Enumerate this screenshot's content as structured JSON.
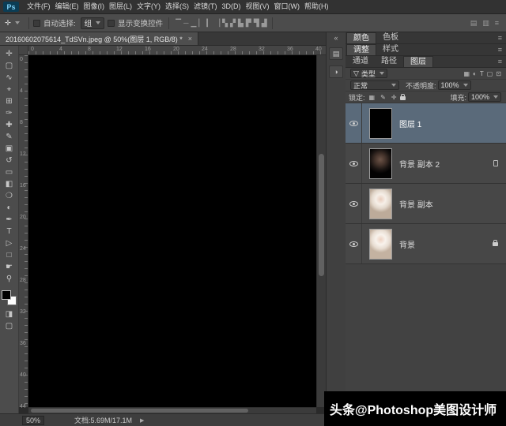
{
  "colors": {
    "ui_background": "#4c4c4c",
    "selected_layer_row": "#5a6a7a",
    "canvas_image": "#000000",
    "watermark_bg": "#000000",
    "watermark_text": "#ffffff"
  },
  "app": {
    "logo": "Ps",
    "menus": [
      "文件(F)",
      "编辑(E)",
      "图像(I)",
      "图层(L)",
      "文字(Y)",
      "选择(S)",
      "滤镜(T)",
      "3D(D)",
      "视图(V)",
      "窗口(W)",
      "帮助(H)"
    ]
  },
  "options_bar": {
    "tool_preset_icon": "✛",
    "auto_select": {
      "label": "自动选择:",
      "value": "组",
      "checked": false
    },
    "show_transform": {
      "label": "显示变换控件",
      "checked": false
    },
    "align_icons": [
      {
        "name": "align-top-edges-icon",
        "glyph": "▔"
      },
      {
        "name": "align-vertical-centers-icon",
        "glyph": "─"
      },
      {
        "name": "align-bottom-edges-icon",
        "glyph": "▁"
      },
      {
        "name": "align-left-edges-icon",
        "glyph": "▏"
      },
      {
        "name": "align-horizontal-centers-icon",
        "glyph": "▎"
      },
      {
        "name": "align-right-edges-icon",
        "glyph": "▕"
      },
      {
        "name": "distribute-top-icon",
        "glyph": "▚"
      },
      {
        "name": "distribute-vcenter-icon",
        "glyph": "▞"
      },
      {
        "name": "distribute-bottom-icon",
        "glyph": "▙"
      },
      {
        "name": "distribute-left-icon",
        "glyph": "▛"
      },
      {
        "name": "distribute-hcenter-icon",
        "glyph": "▜"
      },
      {
        "name": "distribute-right-icon",
        "glyph": "▟"
      }
    ],
    "right_icons": [
      {
        "name": "workspace-grid-icon",
        "glyph": "▤"
      },
      {
        "name": "workspace-columns-icon",
        "glyph": "▥"
      },
      {
        "name": "panel-list-icon",
        "glyph": "≡"
      }
    ]
  },
  "document_window": {
    "tab_title": "20160602075614_TdSVn.jpeg @ 50%(图层 1, RGB/8) *",
    "close_glyph": "×",
    "zoom": "50%",
    "doc_size": "文档:5.69M/17.1M",
    "flyout_glyph": "▶"
  },
  "toolbar": {
    "tools": [
      {
        "name": "move-tool",
        "glyph": "✛"
      },
      {
        "name": "marquee-tool",
        "glyph": "▢"
      },
      {
        "name": "lasso-tool",
        "glyph": "∿"
      },
      {
        "name": "quick-select-tool",
        "glyph": "⌖"
      },
      {
        "name": "crop-tool",
        "glyph": "⊞"
      },
      {
        "name": "eyedropper-tool",
        "glyph": "✑"
      },
      {
        "name": "healing-brush-tool",
        "glyph": "✚"
      },
      {
        "name": "brush-tool",
        "glyph": "✎"
      },
      {
        "name": "clone-stamp-tool",
        "glyph": "▣"
      },
      {
        "name": "history-brush-tool",
        "glyph": "↺"
      },
      {
        "name": "eraser-tool",
        "glyph": "▭"
      },
      {
        "name": "gradient-tool",
        "glyph": "◧"
      },
      {
        "name": "blur-tool",
        "glyph": "❍"
      },
      {
        "name": "dodge-tool",
        "glyph": "◐"
      },
      {
        "name": "pen-tool",
        "glyph": "✒"
      },
      {
        "name": "type-tool",
        "glyph": "T"
      },
      {
        "name": "path-select-tool",
        "glyph": "▷"
      },
      {
        "name": "shape-tool",
        "glyph": "□"
      },
      {
        "name": "hand-tool",
        "glyph": "☛"
      },
      {
        "name": "zoom-tool",
        "glyph": "⚲"
      }
    ],
    "bottom_tools": [
      {
        "name": "quick-mask-button",
        "glyph": "◨"
      },
      {
        "name": "screen-mode-button",
        "glyph": "▢"
      }
    ]
  },
  "rulers": {
    "h_labels": [
      "0",
      "4",
      "8",
      "12",
      "16",
      "20",
      "24",
      "28",
      "32",
      "36",
      "40"
    ],
    "v_labels": [
      "0",
      "4",
      "8",
      "12",
      "16",
      "20",
      "24",
      "28",
      "32",
      "36",
      "40",
      "44"
    ]
  },
  "dock": {
    "collapse_glyph": "«",
    "icons": [
      {
        "name": "docked-panel-icon-1",
        "glyph": "▤"
      },
      {
        "name": "docked-panel-icon-2",
        "glyph": "◑"
      }
    ]
  },
  "panels": {
    "panel_menu_glyph": "≡",
    "groups": [
      {
        "tabs": [
          {
            "label": "颜色",
            "active": true
          },
          {
            "label": "色板",
            "active": false
          }
        ]
      },
      {
        "tabs": [
          {
            "label": "调整",
            "active": true
          },
          {
            "label": "样式",
            "active": false
          }
        ]
      },
      {
        "tabs": [
          {
            "label": "通道",
            "active": false
          },
          {
            "label": "路径",
            "active": false
          },
          {
            "label": "图层",
            "active": true
          }
        ]
      }
    ],
    "layers_panel": {
      "filter": {
        "icon": "▽",
        "label": "类型",
        "icons": [
          {
            "name": "filter-pixel-layers-icon",
            "glyph": "▦"
          },
          {
            "name": "filter-adjustment-layers-icon",
            "glyph": "◐"
          },
          {
            "name": "filter-type-layers-icon",
            "glyph": "T"
          },
          {
            "name": "filter-shape-layers-icon",
            "glyph": "▢"
          },
          {
            "name": "filter-smart-objects-icon",
            "glyph": "⊡"
          }
        ]
      },
      "blend_mode": "正常",
      "opacity": {
        "label": "不透明度:",
        "value": "100%"
      },
      "lock": {
        "label": "锁定:",
        "icons": [
          {
            "name": "lock-transparency-icon",
            "glyph": "▦"
          },
          {
            "name": "lock-pixels-icon",
            "glyph": "✎"
          },
          {
            "name": "lock-position-icon",
            "glyph": "✛"
          },
          {
            "name": "lock-all-icon",
            "css_lock": true
          }
        ]
      },
      "fill": {
        "label": "填充:",
        "value": "100%"
      },
      "layers": [
        {
          "name": "图层 1",
          "selected": true,
          "thumb": "black",
          "visible": true
        },
        {
          "name": "背景 副本 2",
          "selected": false,
          "thumb": "dark-portrait",
          "visible": true,
          "badge": true
        },
        {
          "name": "背景 副本",
          "selected": false,
          "thumb": "light-portrait",
          "visible": true
        },
        {
          "name": "背景",
          "selected": false,
          "thumb": "light-portrait-2",
          "visible": true,
          "locked": true
        }
      ]
    }
  },
  "watermark": {
    "text": "头条@Photoshop美图设计师"
  }
}
